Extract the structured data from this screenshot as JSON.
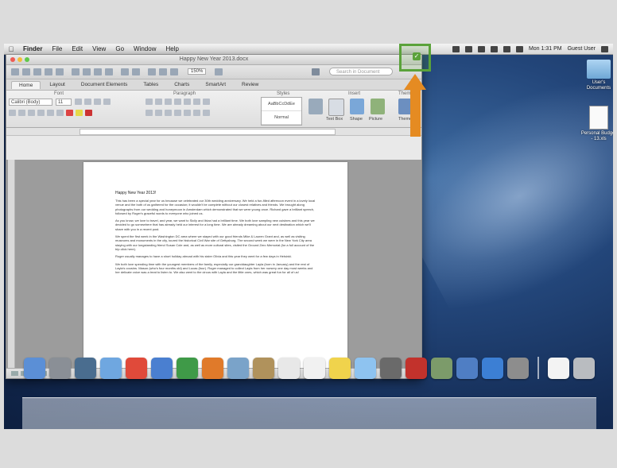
{
  "menubar": {
    "apple": "",
    "items": [
      "Finder",
      "File",
      "Edit",
      "View",
      "Go",
      "Window",
      "Help"
    ],
    "clock": "Mon 1:31 PM",
    "user": "Guest User"
  },
  "window": {
    "title": "Happy New Year 2013.docx",
    "search_placeholder": "Search in Document",
    "zoom": "150%",
    "tabs": [
      "Home",
      "Layout",
      "Document Elements",
      "Tables",
      "Charts",
      "SmartArt",
      "Review"
    ],
    "ribbon_groups": [
      "Font",
      "Paragraph",
      "Styles",
      "Insert",
      "Themes"
    ],
    "font_name": "Calibri (Body)",
    "font_size": "11",
    "styles": [
      "AaBbCcDdEe",
      "Normal"
    ],
    "insert_labels": [
      "Text Box",
      "Shape",
      "Picture",
      "Themes"
    ]
  },
  "document": {
    "title": "Happy New Year 2013!",
    "paragraphs": [
      "This has been a special year for us because we celebrated our 30th wedding anniversary. We held a fun-filled afternoon event in a lovely local venue and the both of us gathered for the occasion; it wouldn't be complete without our closest relatives and friends. We brought along photographs from our wedding and honeymoon in Amsterdam which demonstrated that we were young once. Richard gave a brilliant speech, followed by Roger's graceful words to everyone who joined us.",
      "As you know, we love to travel, and year, we want to Sicily and Ibiza had a brilliant time. We both love sampling new cuisines and this year we decided to go somewhere that has already held our interest for a long time. We are already dreaming about our next destination which we'll share with you in a recent post.",
      "We spent the first week in the Washington DC area where we stayed with our good friends Mike & Lauren Grant and, as well as visiting museums and monuments in the city, toured the historical Civil War site of Gettysburg. The second week we were in the New York City area staying with our longstanding friend Susan Cole and, as well as more cultural sites, visited the Ground Zero Memorial (for a full account of the trip click here).",
      "Roger usually manages to have a short holiday abroad with his sister Olivia and this year they went for a few days in Helsinki.",
      "We both love spending time with the youngest members of the family, especially our granddaughter Layla (born in January) and the rest of Layla's cousins. Mason (who's four months old) and Lucas (four). Roger managed to collect Layla from her nursery one day most weeks and her delicate voice was a treat to listen to. We also went to the circus with Layla and the little ones, which was great fun for all of us!"
    ]
  },
  "desktop": {
    "icons": [
      {
        "label": "User's Documents",
        "kind": "folder"
      },
      {
        "label": "Personal Budget - 13.xls",
        "kind": "file"
      }
    ]
  },
  "highlight": {
    "check": "✓"
  },
  "dock": {
    "apps": [
      {
        "name": "finder-icon",
        "color": "#5b8fd6"
      },
      {
        "name": "launchpad-icon",
        "color": "#8a8f96"
      },
      {
        "name": "mission-control-icon",
        "color": "#4a6d8f"
      },
      {
        "name": "safari-icon",
        "color": "#6fa7e0"
      },
      {
        "name": "chrome-icon",
        "color": "#e04a3a"
      },
      {
        "name": "word-icon",
        "color": "#4a7fd0"
      },
      {
        "name": "excel-icon",
        "color": "#3f9a48"
      },
      {
        "name": "powerpoint-icon",
        "color": "#e07a2a"
      },
      {
        "name": "preview-icon",
        "color": "#7aa3c9"
      },
      {
        "name": "contacts-icon",
        "color": "#b0925c"
      },
      {
        "name": "calendar-icon",
        "color": "#e8e8e8"
      },
      {
        "name": "textedit-icon",
        "color": "#f1f1f1"
      },
      {
        "name": "stickies-icon",
        "color": "#f0d34c"
      },
      {
        "name": "messages-icon",
        "color": "#8ec3f0"
      },
      {
        "name": "facetime-icon",
        "color": "#6a6a6a"
      },
      {
        "name": "photobooth-icon",
        "color": "#c2322c"
      },
      {
        "name": "iphoto-icon",
        "color": "#7c9b6a"
      },
      {
        "name": "itunes-icon",
        "color": "#4f7ec4"
      },
      {
        "name": "app-store-icon",
        "color": "#3c7fd4"
      },
      {
        "name": "system-preferences-icon",
        "color": "#8d8d8d"
      },
      {
        "name": "documents-stack-icon",
        "color": "#f3f3f3"
      },
      {
        "name": "trash-icon",
        "color": "#b9bcc0"
      }
    ]
  }
}
